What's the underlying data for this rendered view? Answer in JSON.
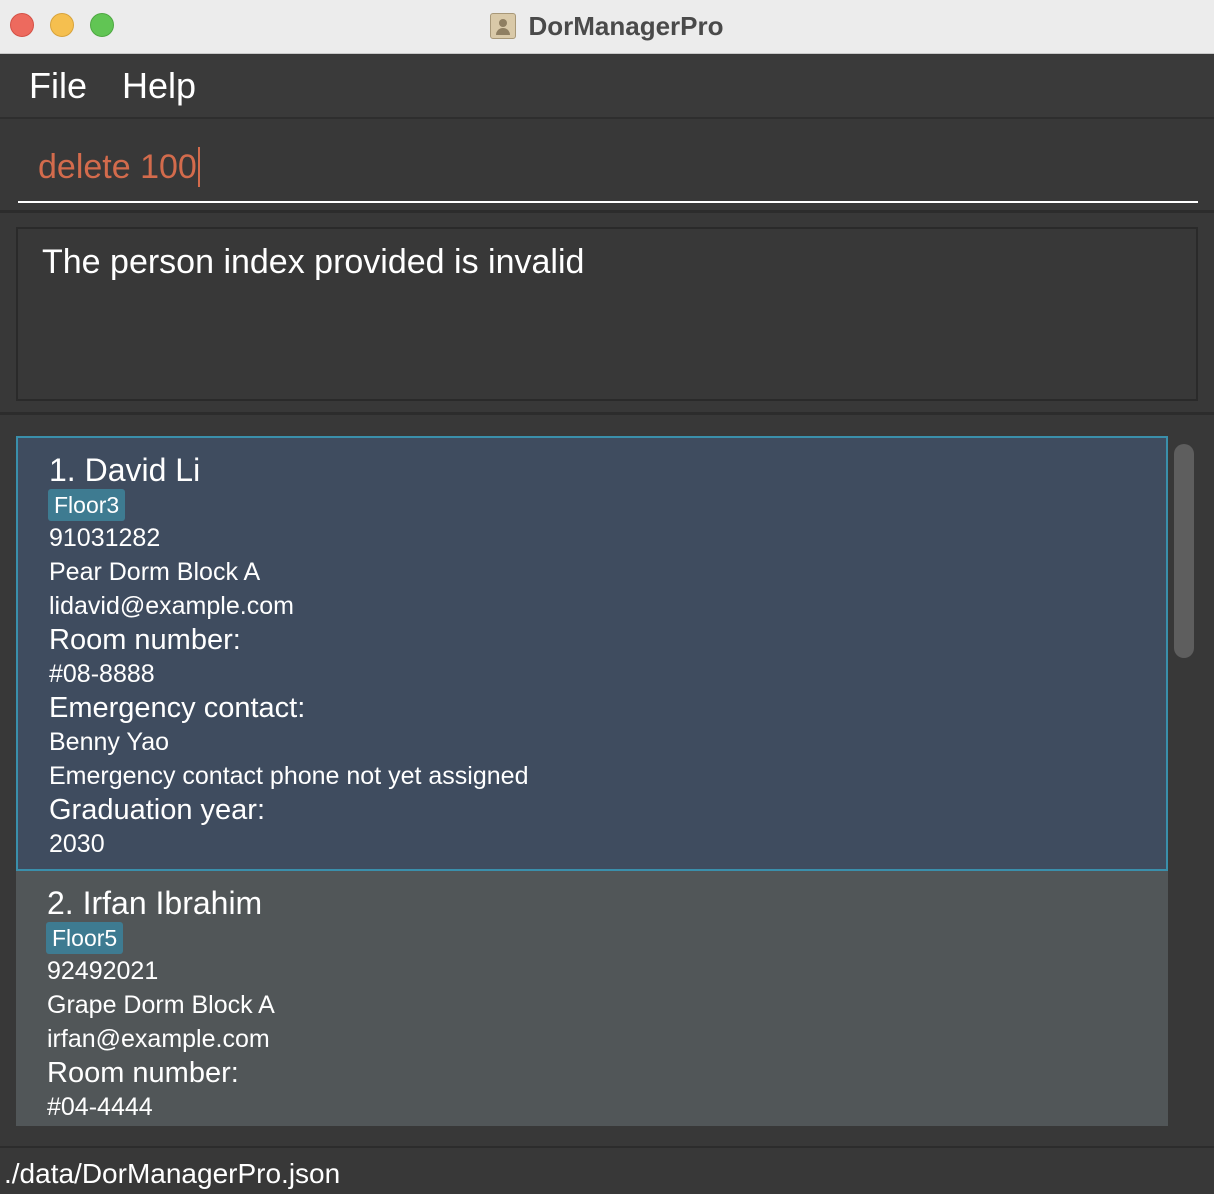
{
  "window": {
    "title": "DorManagerPro"
  },
  "menu": {
    "file": "File",
    "help": "Help"
  },
  "command": {
    "value": "delete 100"
  },
  "result": {
    "message": "The person index provided is invalid"
  },
  "persons": [
    {
      "name": "1. David Li",
      "tag": "Floor3",
      "phone": "91031282",
      "address": "Pear Dorm Block A",
      "email": "lidavid@example.com",
      "room_label": "Room number:",
      "room": "#08-8888",
      "emergency_label": "Emergency contact:",
      "emergency_name": "Benny Yao",
      "emergency_phone": "Emergency contact phone not yet assigned",
      "grad_label": "Graduation year:",
      "grad_year": "2030"
    },
    {
      "name": "2. Irfan Ibrahim",
      "tag": "Floor5",
      "phone": "92492021",
      "address": "Grape Dorm Block A",
      "email": "irfan@example.com",
      "room_label": "Room number:",
      "room": "#04-4444"
    }
  ],
  "status": {
    "path": "./data/DorManagerPro.json"
  },
  "colors": {
    "command_error": "#d36b4c",
    "selected_card": "#3f4c5f",
    "tag": "#3e7b91"
  }
}
